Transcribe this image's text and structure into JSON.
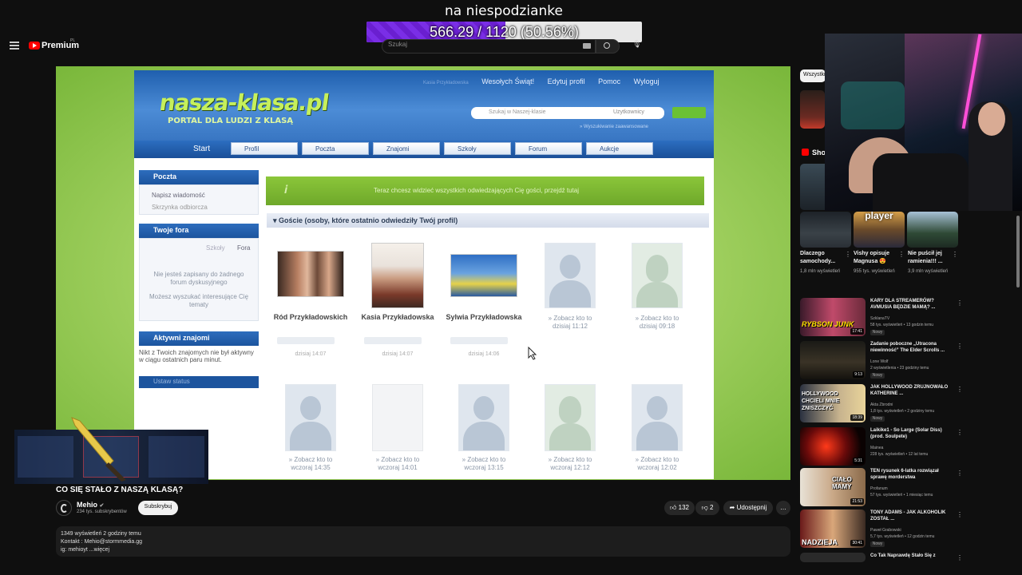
{
  "overlay": {
    "title": "na niespodzianke",
    "goal_text": "566.29 / 1120 (50.56%)",
    "goal_fraction": 0.5056,
    "bar_color": "#7a2ee6"
  },
  "youtube": {
    "logo_text": "Premium",
    "logo_region": "PL",
    "search_placeholder": "Szukaj",
    "video_title": "CO SIĘ STAŁO Z NASZĄ KLASĄ?",
    "channel_name": "Mehio",
    "channel_subs": "234 tys. subskrybentów",
    "subscribe_label": "Subskrybuj",
    "likes": "132",
    "dislikes": "2",
    "share_label": "Udostępnij",
    "more_label": "…",
    "description": {
      "line1": "1349 wyświetleń  2 godziny temu",
      "line2": "Kontakt : Mehio@stormmedia.gg",
      "line3": "ig: mehioyt ...więcej"
    },
    "filter_chip": "Wszystkie",
    "shorts_label": "Sho",
    "shorts": [
      {
        "title": "Dlaczego samochody...",
        "views": "1,8 mln wyświetleń"
      },
      {
        "title": "Vishy opisuje Magnusa 😍",
        "views": "955 tys. wyświetleń",
        "overlay": "player"
      },
      {
        "title": "Nie puścił jej ramienia!!! ...",
        "views": "3,9 mln wyświetleń"
      }
    ],
    "recommendations": [
      {
        "title": "KARY DLA STREAMERÓW? AVMUSIA BĘDZIE MAMĄ? ...",
        "channel": "SzklanaTV",
        "meta": "58 tys. wyświetleń • 13 godzin temu",
        "badge": "Nowy",
        "duration": "17:41",
        "thumb_text": "RYBSON JUNK"
      },
      {
        "title": "Zadanie poboczne „Utracona niewinność” The Elder Scrolls ...",
        "channel": "Lone Wolf",
        "meta": "2 wyświetlenia • 23 godziny temu",
        "badge": "Nowy",
        "duration": "9:13",
        "thumb_text": ""
      },
      {
        "title": "JAK HOLLYWOOD ZRUJNOWAŁO KATHERINE ...",
        "channel": "Akta Zbrodni",
        "meta": "1,8 tys. wyświetleń • 2 godziny temu",
        "badge": "Nowy",
        "duration": "18:39",
        "thumb_text": "HOLLYWOOD CHCIELI MNIE ZNISZCZYĆ"
      },
      {
        "title": "Laikike1 - So Large (Solar Diss) (prod. Soulpete)",
        "channel": "Mainea",
        "meta": "228 tys. wyświetleń • 12 lat temu",
        "badge": "",
        "duration": "5:31",
        "thumb_text": ""
      },
      {
        "title": "TEN rysunek 6-latka rozwiązał sprawę morderstwa",
        "channel": "Profanum",
        "meta": "57 tys. wyświetleń • 1 miesiąc temu",
        "badge": "",
        "duration": "21:53",
        "thumb_text": "CIAŁO MAMY"
      },
      {
        "title": "TONY ADAMS - JAK ALKOHOLIK ZOSTAŁ ...",
        "channel": "Paweł Grabowski",
        "meta": "5,7 tys. wyświetleń • 12 godzin temu",
        "badge": "Nowy",
        "duration": "30:41",
        "thumb_text": "NADZIEJA"
      },
      {
        "title": "Co Tak Naprawdę Stało Się z",
        "channel": "",
        "meta": "",
        "badge": "",
        "duration": "",
        "thumb_text": ""
      }
    ]
  },
  "nk": {
    "logo": "nasza-klasa.pl",
    "slogan": "PORTAL DLA LUDZI Z KLASĄ",
    "top_links": [
      "Wesołych Świąt!",
      "Edytuj profil",
      "Pomoc",
      "Wyloguj"
    ],
    "top_links_dim": "Kasia Przykładowska",
    "search_placeholder": "Szukaj w Naszej-klasie",
    "search_scope": "Uzytkownicy",
    "under_search": "» Wyszukiwanie zaawansowane",
    "nav_start": "Start",
    "nav_tabs": [
      "Profil",
      "Poczta",
      "Znajomi",
      "Szkoły",
      "Forum",
      "Aukcje"
    ],
    "side": {
      "poczta_head": "Poczta",
      "poczta_items": [
        "Napisz wiadomość",
        "Skrzynka odbiorcza"
      ],
      "fora_head": "Twoje fora",
      "fora_tabs": [
        "Szkoły",
        "Fora"
      ],
      "fora_text1": "Nie jesteś zapisany do żadnego forum dyskusyjnego",
      "fora_text2": "Możesz wyszukać interesujące Cię tematy",
      "active_head": "Aktywni znajomi",
      "active_text": "Nikt z Twoich znajomych nie był aktywny w ciągu ostatnich paru minut.",
      "active_btn": "Ustaw status"
    },
    "green_banner": "Teraz chcesz widzieć wszystkich odwiedzających Cię gości, przejdź tutaj",
    "guests_header": "Goście (osoby, które ostatnio odwiedziły Twój profil)",
    "guests_row1": [
      {
        "name": "Ród Przykładowskich",
        "date": "dzisiaj 14:07",
        "photo": "family"
      },
      {
        "name": "Kasia Przykładowska",
        "date": "dzisiaj 14:07",
        "photo": "mother"
      },
      {
        "name": "Sylwia Przykładowska",
        "date": "dzisiaj 14:06",
        "photo": "beach"
      },
      {
        "name": "» Zobacz kto to",
        "date": "dzisiaj 11:12",
        "photo": "silhouette-m"
      },
      {
        "name": "» Zobacz kto to",
        "date": "dzisiaj 09:18",
        "photo": "silhouette-f"
      }
    ],
    "guests_row2": [
      {
        "name": "» Zobacz kto to",
        "date": "wczoraj 14:35"
      },
      {
        "name": "» Zobacz kto to",
        "date": "wczoraj 14:01"
      },
      {
        "name": "» Zobacz kto to",
        "date": "wczoraj 13:15"
      },
      {
        "name": "» Zobacz kto to",
        "date": "wczoraj 12:12"
      },
      {
        "name": "» Zobacz kto to",
        "date": "wczoraj 12:02"
      }
    ]
  },
  "icons": [
    "menu-icon",
    "youtube-logo-icon",
    "search-icon",
    "keyboard-icon",
    "mic-icon",
    "like-icon",
    "dislike-icon",
    "share-icon",
    "more-icon",
    "cursor-icon",
    "verified-icon"
  ],
  "colors": {
    "yt_bg": "#0f0f0f",
    "nk_blue": "#1f5fae",
    "nk_green": "#7fbf3a"
  }
}
